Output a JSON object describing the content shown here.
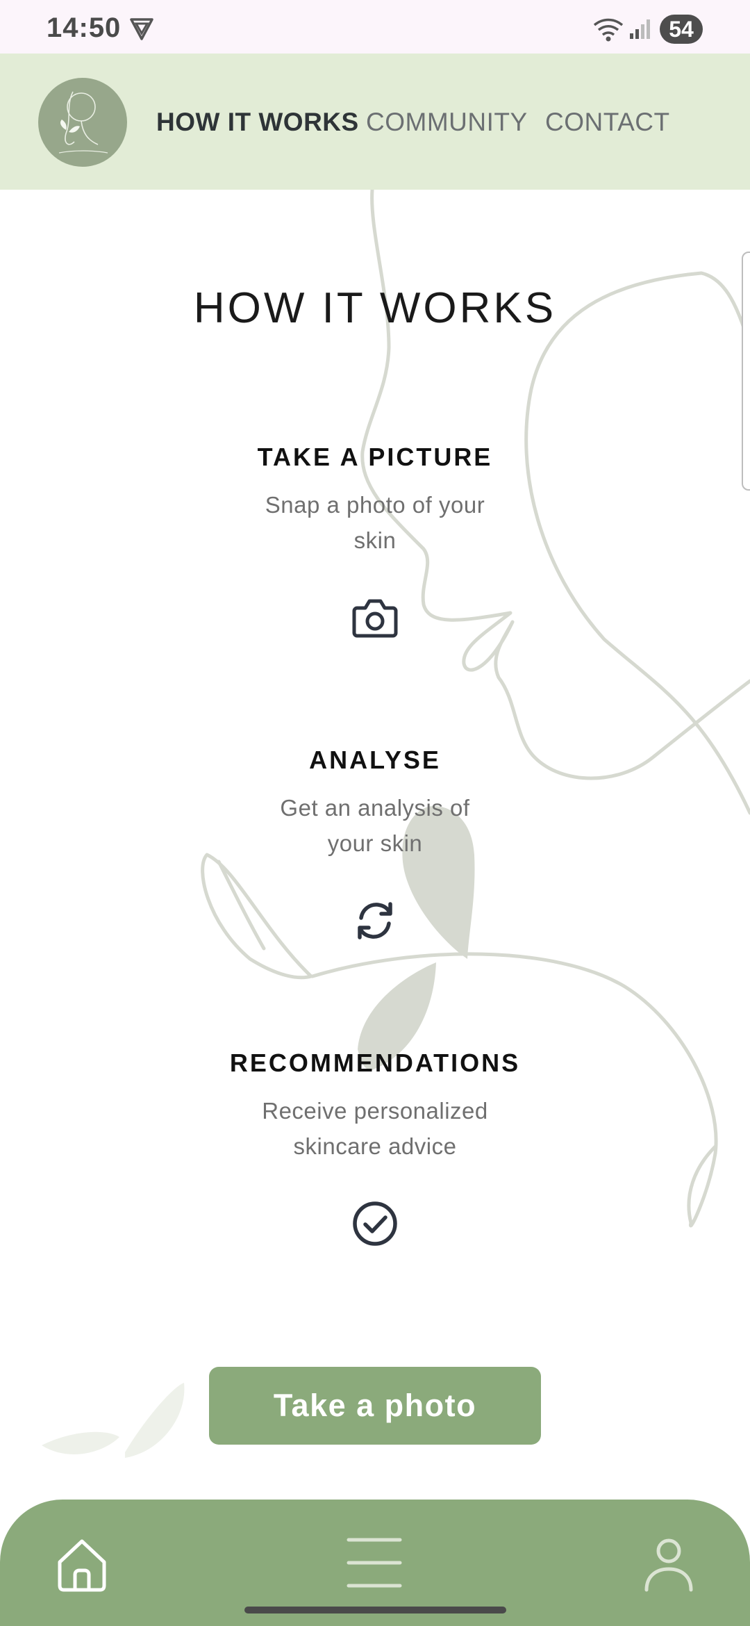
{
  "status_bar": {
    "time": "14:50",
    "battery": "54",
    "icons": [
      "vpn-icon",
      "wifi-icon",
      "signal-icon",
      "battery-icon"
    ]
  },
  "header": {
    "logo_alt": "logo-icon",
    "nav": [
      {
        "label": "HOW IT WORKS",
        "active": true
      },
      {
        "label": "COMMUNITY",
        "active": false
      },
      {
        "label": "CONTACT",
        "active": false
      }
    ]
  },
  "main": {
    "title": "HOW IT WORKS",
    "steps": [
      {
        "title": "TAKE A PICTURE",
        "description": "Snap a photo of your skin",
        "icon": "camera-icon"
      },
      {
        "title": "ANALYSE",
        "description": "Get an analysis of your skin",
        "icon": "refresh-icon"
      },
      {
        "title": "RECOMMENDATIONS",
        "description": "Receive personalized skincare advice",
        "icon": "check-circle-icon"
      }
    ],
    "cta_label": "Take a photo"
  },
  "bottom_nav": {
    "items": [
      "home-icon",
      "menu-icon",
      "profile-icon"
    ]
  },
  "colors": {
    "header_bg": "#e2ecd6",
    "accent": "#8baa7b",
    "line_art": "#d6d9d0",
    "status_bar_bg": "#fcf5fb"
  }
}
